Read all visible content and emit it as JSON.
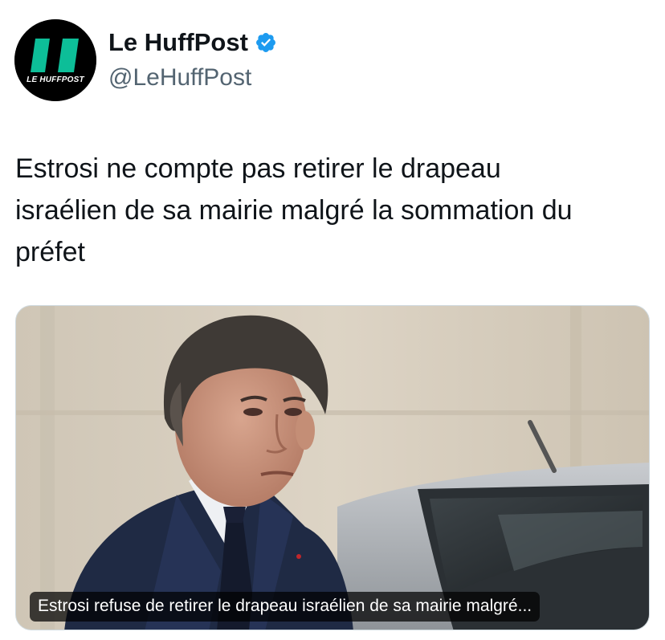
{
  "account": {
    "display_name": "Le HuffPost",
    "handle": "@LeHuffPost",
    "avatar_logo_text": "LE HUFFPOST",
    "avatar_icon": "huffpost-logo",
    "verified_icon": "verified-badge-icon",
    "verified_color": "#1d9bf0",
    "brand_color": "#0dbe98"
  },
  "tweet": {
    "text_line_1": "Estrosi ne compte pas retirer le drapeau",
    "text_line_2": "israélien de sa mairie malgré la sommation du",
    "text_line_3": "préfet"
  },
  "media": {
    "caption": "Estrosi refuse de retirer le drapeau israélien de sa mairie malgré..."
  }
}
